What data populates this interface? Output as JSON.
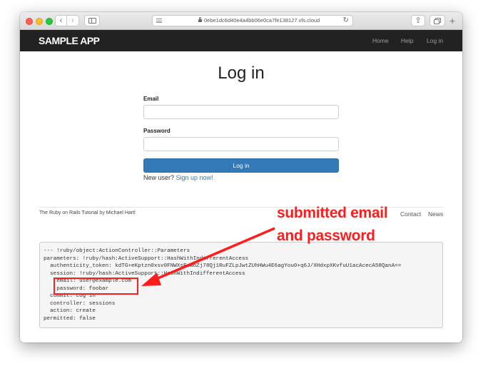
{
  "browser": {
    "url": "0ebe1dc6d40e4a4bb06e0ca7fe138127.vfs.cloud",
    "back_glyph": "‹",
    "forward_glyph": "›",
    "reload_glyph": "↻",
    "share_glyph": "⇪",
    "new_tab_glyph": "+"
  },
  "header": {
    "logo": "SAMPLE APP",
    "nav": {
      "home": "Home",
      "help": "Help",
      "login": "Log in"
    }
  },
  "form": {
    "title": "Log in",
    "email_label": "Email",
    "email_value": "",
    "password_label": "Password",
    "password_value": "",
    "submit_label": "Log in",
    "signup_prompt": "New user? ",
    "signup_link": "Sign up now!"
  },
  "footer": {
    "credit_link1": "The Ruby on Rails Tutorial",
    "credit_by": " by ",
    "credit_link2": "Michael Hartl",
    "contact": "Contact",
    "news": "News"
  },
  "debug": {
    "lines": [
      "--- !ruby/object:ActionController::Parameters",
      "parameters: !ruby/hash:ActiveSupport::HashWithIndifferentAccess",
      "  authenticity_token: kdTG+eKptzn0xsv0FNWXsEewoZj78Qj1RuFZLpJwtZUhHWu4E6agYou0+q6J/XHdxpXKvfuU1acAcecA58QanA==",
      "  session: !ruby/hash:ActiveSupport::HashWithIndifferentAccess",
      "    email: user@example.com",
      "    password: foobar",
      "  commit: Log in",
      "  controller: sessions",
      "  action: create",
      "permitted: false"
    ]
  },
  "annotation": {
    "line1": "submitted email",
    "line2": "and password",
    "color": "#ff1c1c"
  },
  "colors": {
    "header_bg": "#222222",
    "button_bg": "#337ab7",
    "link": "#337ab7"
  }
}
